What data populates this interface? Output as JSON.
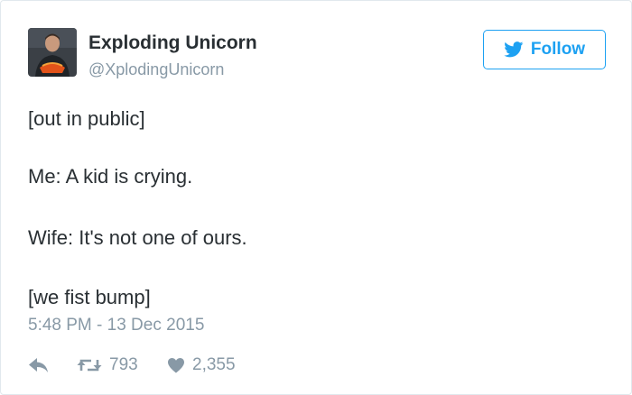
{
  "user": {
    "display_name": "Exploding Unicorn",
    "handle": "@XplodingUnicorn",
    "avatar_icon": "profile-photo"
  },
  "follow_button": {
    "label": "Follow",
    "icon": "twitter-bird-icon",
    "color": "#1da1f2"
  },
  "tweet": {
    "lines": [
      "[out in public]",
      "Me: A kid is crying.",
      "Wife: It's not one of ours.",
      "[we fist bump]"
    ],
    "timestamp": "5:48 PM - 13 Dec 2015"
  },
  "actions": {
    "reply_icon": "reply-icon",
    "retweet_icon": "retweet-icon",
    "retweet_count": "793",
    "like_icon": "heart-icon",
    "like_count": "2,355"
  },
  "colors": {
    "text": "#292f33",
    "muted": "#8899a6",
    "border": "#e1e8ed"
  }
}
